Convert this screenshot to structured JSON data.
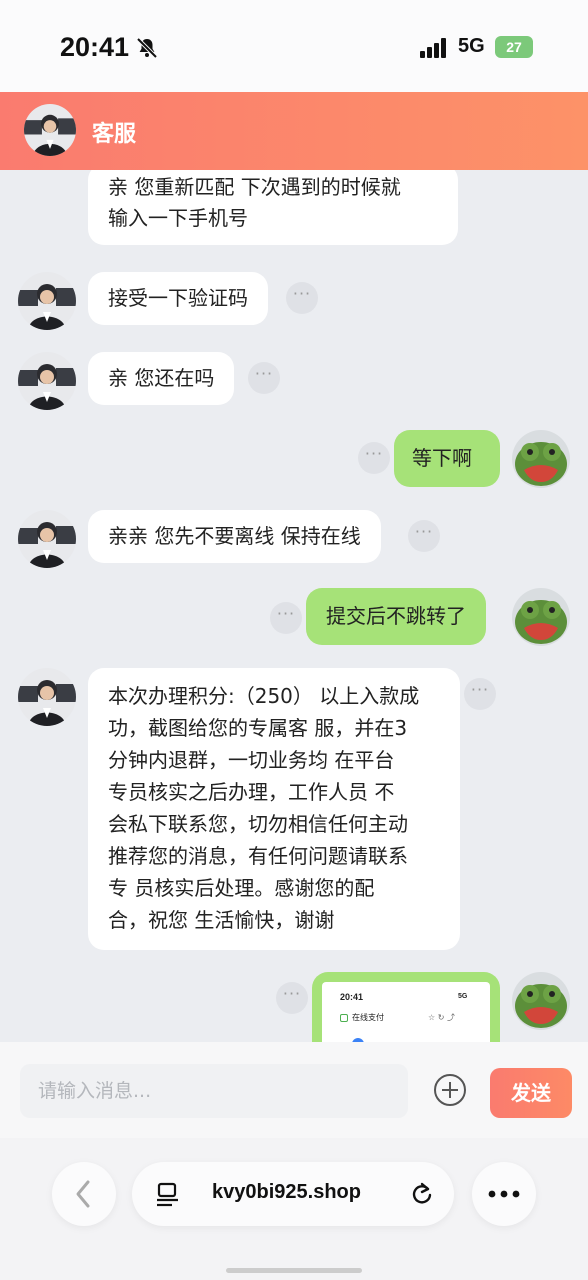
{
  "status_bar": {
    "time": "20:41",
    "network": "5G",
    "battery": "27"
  },
  "header": {
    "title": "客服"
  },
  "messages": [
    {
      "side": "left",
      "lines": [
        "亲 您重新匹配 下次遇到的时候就",
        "输入一下手机号"
      ]
    },
    {
      "side": "left",
      "lines": [
        "接受一下验证码"
      ]
    },
    {
      "side": "left",
      "lines": [
        "亲 您还在吗"
      ]
    },
    {
      "side": "right",
      "lines": [
        "等下啊"
      ]
    },
    {
      "side": "left",
      "lines": [
        "亲亲 您先不要离线 保持在线"
      ]
    },
    {
      "side": "right",
      "lines": [
        "提交后不跳转了"
      ]
    },
    {
      "side": "left",
      "lines": [
        "本次办理积分:（250） 以上入款成",
        "功，截图给您的专属客 服，并在3",
        "分钟内退群，一切业务均 在平台",
        "专员核实之后办理，工作人员 不",
        "会私下联系您，切勿相信任何主动",
        "推荐您的消息，有任何问题请联系",
        "专 员核实后处理。感谢您的配",
        "合，祝您 生活愉快，谢谢"
      ]
    },
    {
      "side": "right",
      "image": {
        "time": "20:41",
        "network": "5G",
        "title": "在线支付"
      }
    }
  ],
  "more_dots": "···",
  "input": {
    "placeholder": "请输入消息..."
  },
  "send_label": "发送",
  "browser": {
    "url": "kvy0bi925.shop"
  },
  "colors": {
    "accent": "#fa7b6f",
    "my_bubble": "#a6e278",
    "background": "#ebedf1"
  }
}
